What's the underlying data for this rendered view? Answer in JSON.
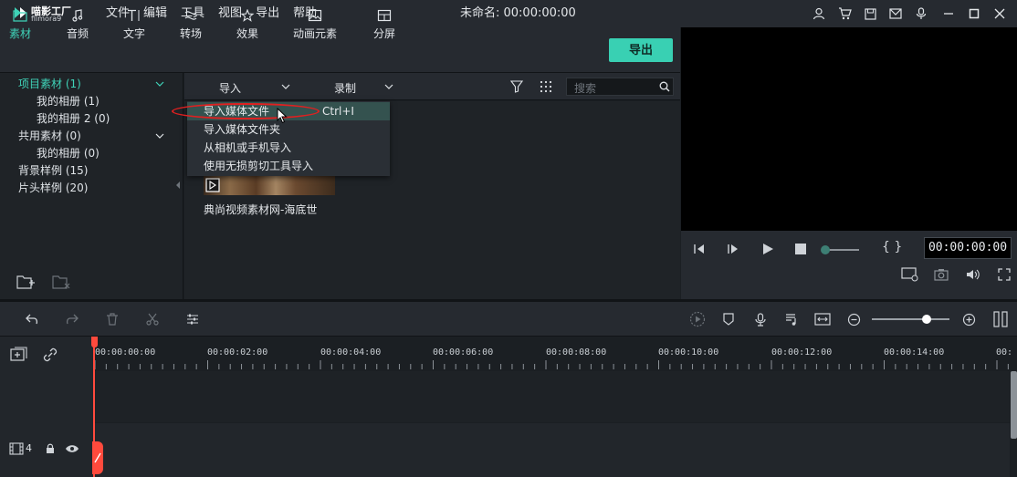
{
  "app": {
    "logo_cn": "喵影工厂",
    "logo_en": "filmora9",
    "menu": [
      "文件",
      "编辑",
      "工具",
      "视图",
      "导出",
      "帮助"
    ],
    "document_title": "未命名: 00:00:00:00"
  },
  "tabs": [
    {
      "label": "素材",
      "icon": "folder-icon",
      "active": true
    },
    {
      "label": "音频",
      "icon": "music-note-icon"
    },
    {
      "label": "文字",
      "icon": "text-icon"
    },
    {
      "label": "转场",
      "icon": "transition-icon"
    },
    {
      "label": "效果",
      "icon": "effects-icon"
    },
    {
      "label": "动画元素",
      "icon": "image-icon"
    },
    {
      "label": "分屏",
      "icon": "split-screen-icon"
    }
  ],
  "export_label": "导出",
  "tree": {
    "items": [
      {
        "label": "项目素材 (1)",
        "selected": true
      },
      {
        "label": "我的相册 (1)"
      },
      {
        "label": "我的相册 2 (0)"
      },
      {
        "label": "共用素材 (0)"
      },
      {
        "label": "我的相册 (0)"
      },
      {
        "label": "背景样例 (15)"
      },
      {
        "label": "片头样例 (20)"
      }
    ]
  },
  "media_toolbar": {
    "import_label": "导入",
    "record_label": "录制",
    "search_placeholder": "搜索"
  },
  "import_menu": [
    {
      "label": "导入媒体文件",
      "shortcut": "Ctrl+I",
      "hover": true
    },
    {
      "label": "导入媒体文件夹"
    },
    {
      "label": "从相机或手机导入"
    },
    {
      "label": "使用无损剪切工具导入"
    }
  ],
  "media_item": {
    "caption": "典尚视频素材网-海底世"
  },
  "preview": {
    "timecode": "00:00:00:00",
    "braces": "{ }"
  },
  "timeline": {
    "ticks": [
      "00:00:00:00",
      "00:00:02:00",
      "00:00:04:00",
      "00:00:06:00",
      "00:00:08:00",
      "00:00:10:00",
      "00:00:12:00",
      "00:00:14:00",
      "00:"
    ],
    "track_number": "4"
  },
  "colors": {
    "accent": "#39d0b3",
    "playhead": "#ff4a3d",
    "annotation": "#e02020"
  }
}
